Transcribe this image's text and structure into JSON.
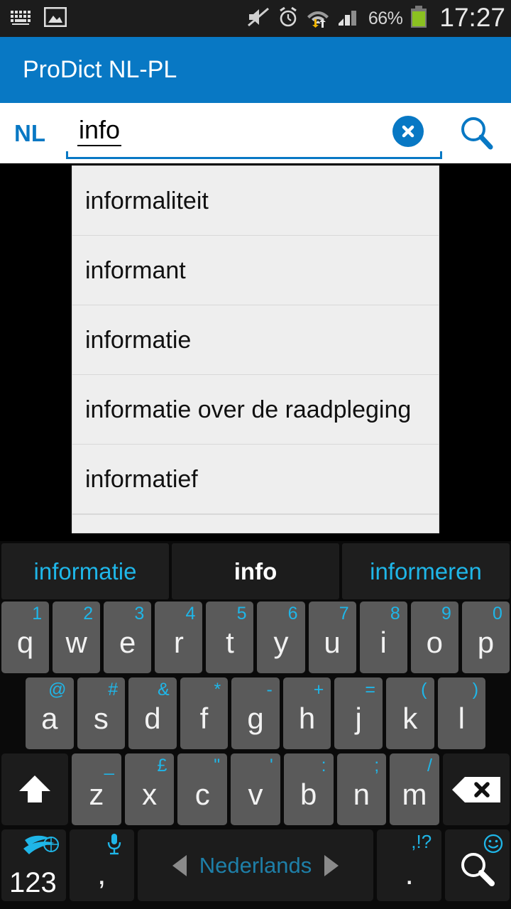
{
  "status_bar": {
    "left_icons": [
      "keyboard-icon",
      "screenshot-image-icon"
    ],
    "right_icons": [
      "mute-icon",
      "alarm-icon",
      "wifi-data-icon",
      "signal-icon"
    ],
    "battery_percent": "66%",
    "clock": "17:27",
    "battery_color": "#8bc121"
  },
  "app_bar": {
    "title": "ProDict NL-PL",
    "background": "#0878c4"
  },
  "search": {
    "lang_label": "NL",
    "value": "info",
    "placeholder": "",
    "clear_label": "clear-icon",
    "search_label": "search-icon",
    "accent": "#0878c4"
  },
  "suggestions": [
    "informaliteit",
    "informant",
    "informatie",
    "informatie over de raadpleging",
    "informatief"
  ],
  "keyboard": {
    "predictions": [
      {
        "text": "informatie",
        "selected": false
      },
      {
        "text": "info",
        "selected": true
      },
      {
        "text": "informeren",
        "selected": false
      }
    ],
    "row1": [
      {
        "main": "q",
        "alt": "1"
      },
      {
        "main": "w",
        "alt": "2"
      },
      {
        "main": "e",
        "alt": "3"
      },
      {
        "main": "r",
        "alt": "4"
      },
      {
        "main": "t",
        "alt": "5"
      },
      {
        "main": "y",
        "alt": "6"
      },
      {
        "main": "u",
        "alt": "7"
      },
      {
        "main": "i",
        "alt": "8"
      },
      {
        "main": "o",
        "alt": "9"
      },
      {
        "main": "p",
        "alt": "0"
      }
    ],
    "row2": [
      {
        "main": "a",
        "alt": "@"
      },
      {
        "main": "s",
        "alt": "#"
      },
      {
        "main": "d",
        "alt": "&"
      },
      {
        "main": "f",
        "alt": "*"
      },
      {
        "main": "g",
        "alt": "-"
      },
      {
        "main": "h",
        "alt": "+"
      },
      {
        "main": "j",
        "alt": "="
      },
      {
        "main": "k",
        "alt": "("
      },
      {
        "main": "l",
        "alt": ")"
      }
    ],
    "row3": [
      {
        "main": "z",
        "alt": "_"
      },
      {
        "main": "x",
        "alt": "£"
      },
      {
        "main": "c",
        "alt": "\""
      },
      {
        "main": "v",
        "alt": "'"
      },
      {
        "main": "b",
        "alt": ":"
      },
      {
        "main": "n",
        "alt": ";"
      },
      {
        "main": "m",
        "alt": "/"
      }
    ],
    "shift_label": "shift-icon",
    "backspace_label": "backspace-icon",
    "num_key_label": "123",
    "num_key_icon": "swiftkey-logo-icon",
    "comma_key_label": ",",
    "comma_key_icon": "microphone-icon",
    "space_label": "Nederlands",
    "period_key_label": ".",
    "period_key_alt": ",!?",
    "enter_key_icon": "search-icon",
    "emoji_key_icon": "smiley-icon",
    "alt_color": "#1fb6e8",
    "key_bg": "#5a5a5a",
    "dark_key_bg": "#1c1c1c"
  }
}
